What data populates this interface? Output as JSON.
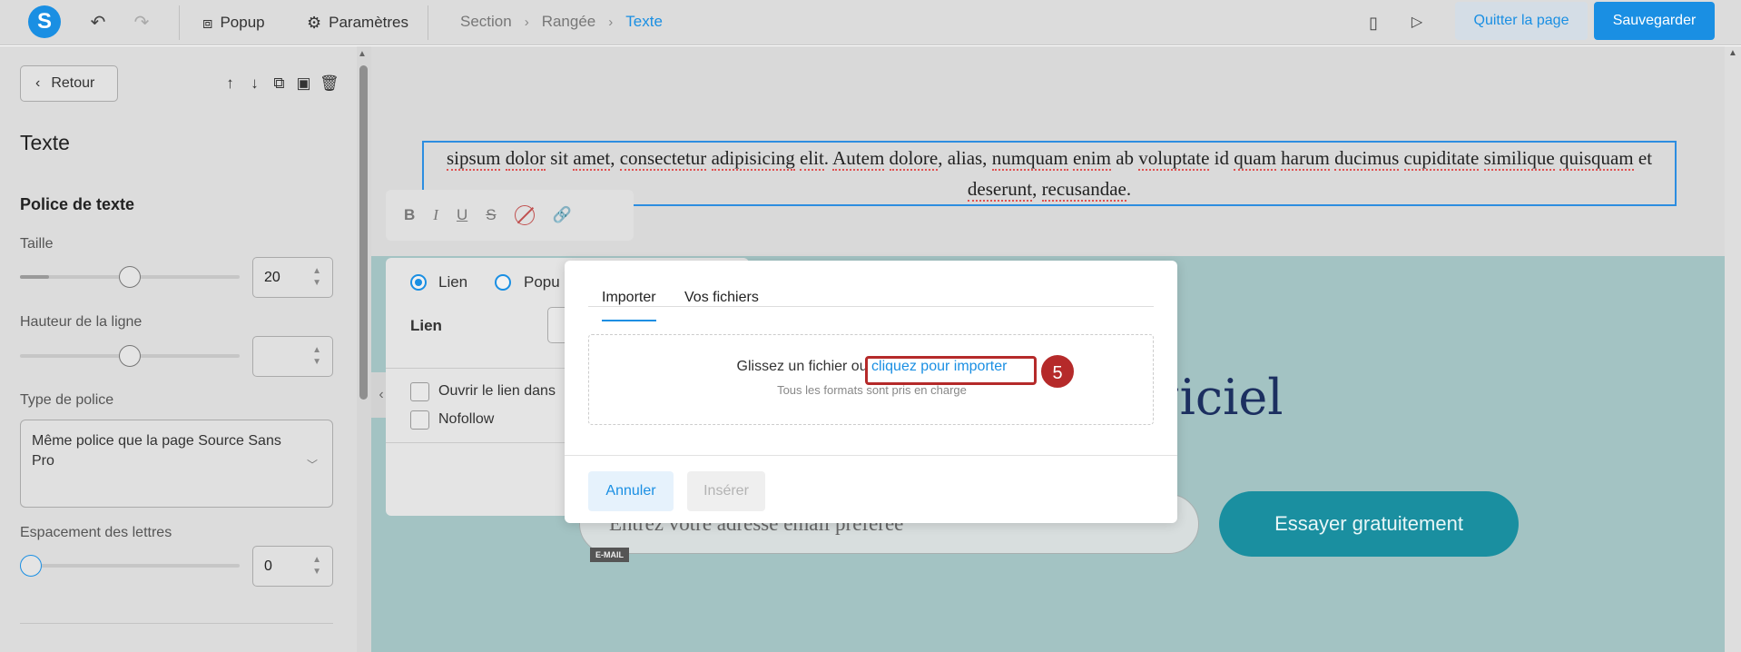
{
  "topbar": {
    "logo_letter": "S",
    "undo_icon": "undo-icon",
    "redo_icon": "redo-icon",
    "popup_label": "Popup",
    "settings_label": "Paramètres",
    "breadcrumb": [
      "Section",
      "Rangée",
      "Texte"
    ],
    "mobile_icon": "mobile-preview-icon",
    "play_icon": "play-icon",
    "quit_label": "Quitter la page",
    "save_label": "Sauvegarder",
    "accent_color": "#1a8fe3"
  },
  "panel": {
    "back_label": "Retour",
    "tools": [
      "arrow-up-icon",
      "arrow-down-icon",
      "copy-icon",
      "save-icon",
      "trash-icon"
    ],
    "title": "Texte",
    "section_title": "Police de texte",
    "size_label": "Taille",
    "size_value": "20",
    "line_height_label": "Hauteur de la ligne",
    "line_height_value": "",
    "font_type_label": "Type de police",
    "font_type_value": "Même police que la page Source Sans Pro",
    "letter_spacing_label": "Espacement des lettres",
    "letter_spacing_value": "0"
  },
  "canvas": {
    "text_segments": [
      "sipsum",
      " ",
      "dolor",
      " sit ",
      "amet",
      ", ",
      "consectetur",
      " ",
      "adipisicing",
      " ",
      "elit",
      ". ",
      "Autem",
      " ",
      "dolore",
      ", alias, ",
      "numquam",
      " ",
      "enim",
      " ab ",
      "voluptate",
      " id ",
      "quam",
      " ",
      "harum",
      " ",
      "ducimus",
      " ",
      "cupiditate",
      " ",
      "similique",
      " ",
      "quisquam",
      " et ",
      "deserunt",
      ", ",
      "recusandae",
      "."
    ],
    "heading_fragment": "giciel",
    "email_placeholder": "Entrez votre adresse email préférée",
    "email_tag": "E-MAIL",
    "cta_label": "Essayer gratuitement"
  },
  "link_panel": {
    "radio_link": "Lien",
    "radio_popup": "Popu",
    "link_label": "Lien",
    "open_new_label": "Ouvrir le lien dans",
    "nofollow_label": "Nofollow"
  },
  "modal": {
    "tab_import": "Importer",
    "tab_files": "Vos fichiers",
    "drop_text": "Glissez un fichier ou",
    "drop_link": "cliquez pour importer",
    "drop_hint": "Tous les formats sont pris en charge",
    "step_number": "5",
    "cancel_label": "Annuler",
    "insert_label": "Insérer"
  }
}
